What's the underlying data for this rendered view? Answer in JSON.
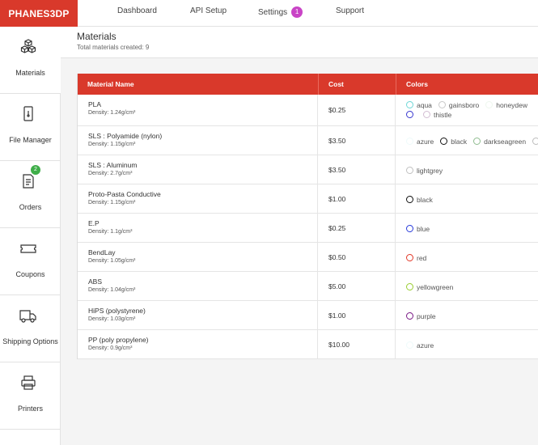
{
  "app": {
    "logo": "PHANES3DP"
  },
  "nav": [
    {
      "label": "Dashboard"
    },
    {
      "label": "API Setup"
    },
    {
      "label": "Settings",
      "badge": "1"
    },
    {
      "label": "Support"
    }
  ],
  "sidebar": {
    "items": [
      {
        "label": "Materials",
        "icon": "cubes-icon"
      },
      {
        "label": "File Manager",
        "icon": "file-icon"
      },
      {
        "label": "Orders",
        "icon": "document-icon",
        "badge": "2"
      },
      {
        "label": "Coupons",
        "icon": "ticket-icon"
      },
      {
        "label": "Shipping Options",
        "icon": "truck-icon"
      },
      {
        "label": "Printers",
        "icon": "printer-icon"
      }
    ]
  },
  "page": {
    "title": "Materials",
    "subtitle": "Total materials created: 9"
  },
  "table": {
    "headers": [
      "Material Name",
      "Cost",
      "Colors"
    ],
    "rows": [
      {
        "name": "PLA",
        "density": "Density: 1.24g/cm³",
        "cost": "$0.25",
        "colors": [
          {
            "name": "aqua",
            "hex": "#6fd7d7"
          },
          {
            "name": "gainsboro",
            "hex": "#c8c8c8"
          },
          {
            "name": "honeydew",
            "hex": "#eef7ee"
          },
          {
            "name": "",
            "hex": "#3a3ad0"
          },
          {
            "name": "thistle",
            "hex": "#d2bcd2"
          }
        ]
      },
      {
        "name": "SLS : Polyamide (nylon)",
        "density": "Density: 1.15g/cm³",
        "cost": "$3.50",
        "colors": [
          {
            "name": "azure",
            "hex": "#eefafa"
          },
          {
            "name": "black",
            "hex": "#111111"
          },
          {
            "name": "darkseagreen",
            "hex": "#8fbc8f"
          },
          {
            "name": "",
            "hex": "#bbbbbb"
          }
        ]
      },
      {
        "name": "SLS : Aluminum",
        "density": "Density: 2.7g/cm³",
        "cost": "$3.50",
        "colors": [
          {
            "name": "lightgrey",
            "hex": "#c0c0c0"
          }
        ]
      },
      {
        "name": "Proto-Pasta Conductive",
        "density": "Density: 1.15g/cm³",
        "cost": "$1.00",
        "colors": [
          {
            "name": "black",
            "hex": "#111111"
          }
        ]
      },
      {
        "name": "E.P",
        "density": "Density: 1.1g/cm³",
        "cost": "$0.25",
        "colors": [
          {
            "name": "blue",
            "hex": "#2a3ddb"
          }
        ]
      },
      {
        "name": "BendLay",
        "density": "Density: 1.05g/cm³",
        "cost": "$0.50",
        "colors": [
          {
            "name": "red",
            "hex": "#e23a2a"
          }
        ]
      },
      {
        "name": "ABS",
        "density": "Density: 1.04g/cm³",
        "cost": "$5.00",
        "colors": [
          {
            "name": "yellowgreen",
            "hex": "#9acd32"
          }
        ]
      },
      {
        "name": "HiPS (polystyrene)",
        "density": "Density: 1.03g/cm³",
        "cost": "$1.00",
        "colors": [
          {
            "name": "purple",
            "hex": "#7a1a86"
          }
        ]
      },
      {
        "name": "PP (poly propylene)",
        "density": "Density: 0.9g/cm³",
        "cost": "$10.00",
        "colors": [
          {
            "name": "azure",
            "hex": "#eefafa"
          }
        ]
      }
    ]
  },
  "colors": {
    "brand": "#d9392b",
    "badge_settings": "#c944c6",
    "badge_orders": "#3fae49"
  }
}
